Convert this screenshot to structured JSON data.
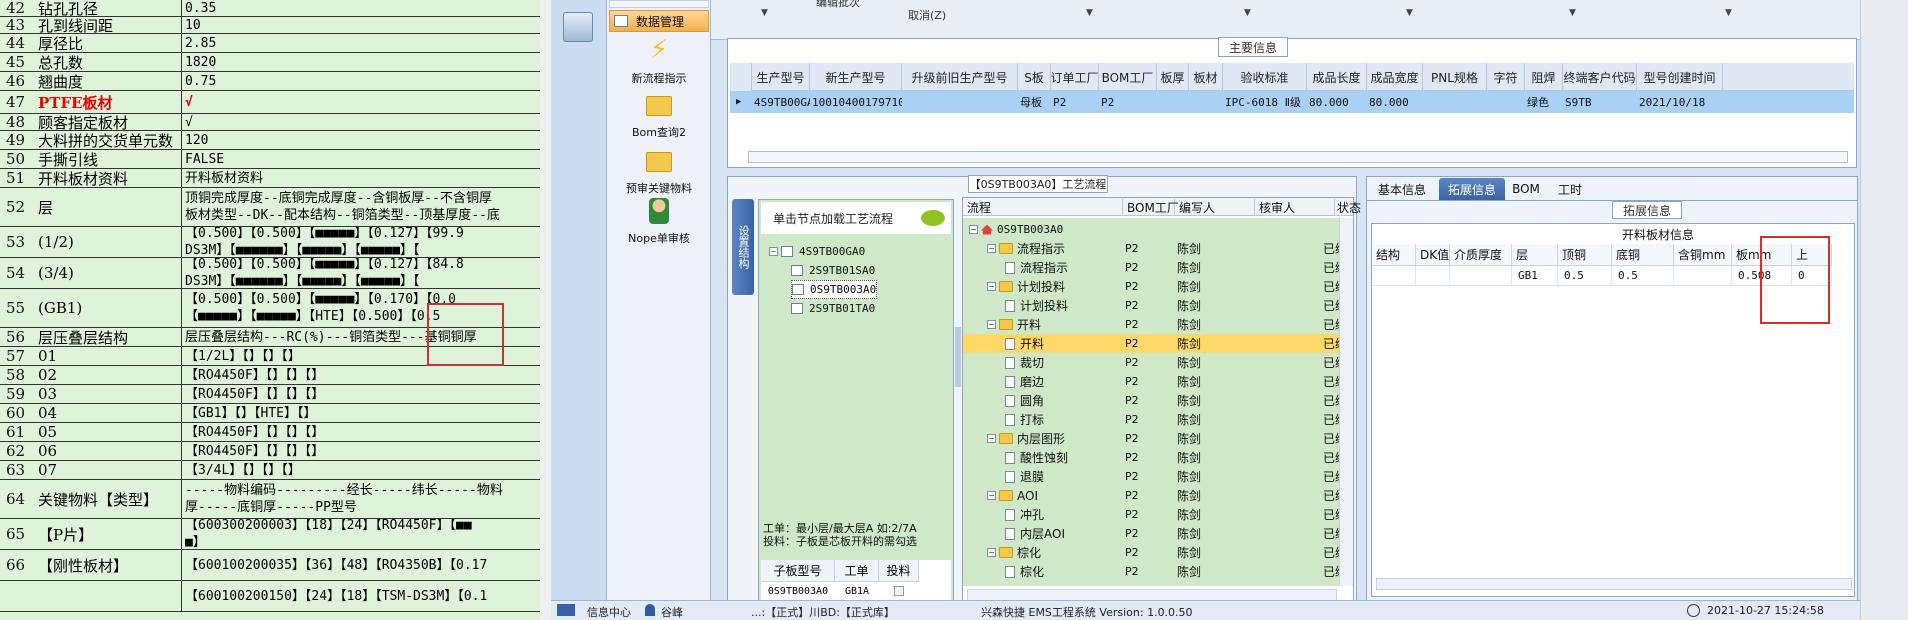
{
  "sheet": {
    "rows": [
      {
        "n": "42",
        "k": "钻孔孔径",
        "v": "0.35"
      },
      {
        "n": "43",
        "k": "孔到线间距",
        "v": "10"
      },
      {
        "n": "44",
        "k": "厚径比",
        "v": "2.85"
      },
      {
        "n": "45",
        "k": "总孔数",
        "v": "1820"
      },
      {
        "n": "46",
        "k": "翘曲度",
        "v": "0.75"
      },
      {
        "n": "47",
        "k": "PTFE板材",
        "v": "√"
      },
      {
        "n": "48",
        "k": "顾客指定板材",
        "v": "√"
      },
      {
        "n": "49",
        "k": "大料拼的交货单元数",
        "v": "120"
      },
      {
        "n": "50",
        "k": "手撕引线",
        "v": "FALSE"
      },
      {
        "n": "51",
        "k": "开料板材资料",
        "v": "开料板材资料"
      },
      {
        "n": "52",
        "k": "层",
        "v": "顶铜完成厚度--底铜完成厚度--含铜板厚--不含铜厚\n板材类型--DK--配本结构--铜箔类型--顶基厚度--底"
      },
      {
        "n": "53",
        "k": "(1/2)",
        "v": "【0.500】【0.500】【■■■■■】【0.127】【99.9\nDS3M】【■■■■■■】【■■■■■】【■■■■■】【"
      },
      {
        "n": "54",
        "k": "(3/4)",
        "v": "【0.500】【0.500】【■■■■■】【0.127】【84.8\nDS3M】【■■■■■■】【■■■■■】【■■■■■】【"
      },
      {
        "n": "55",
        "k": "(GB1)",
        "v": "【0.500】【0.500】【■■■■■】【0.170】【0.0\n【■■■■■】【■■■■■】【HTE】【0.500】【0.5"
      },
      {
        "n": "56",
        "k": "层压叠层结构",
        "v": "层压叠层结构---RC(%)---铜箔类型---基铜铜厚"
      },
      {
        "n": "57",
        "k": "01",
        "v": "【1/2L】【】【】【】"
      },
      {
        "n": "58",
        "k": "02",
        "v": "【RO4450F】【】【】【】"
      },
      {
        "n": "59",
        "k": "03",
        "v": "【RO4450F】【】【】【】"
      },
      {
        "n": "60",
        "k": "04",
        "v": "【GB1】【】【HTE】【】"
      },
      {
        "n": "61",
        "k": "05",
        "v": "【RO4450F】【】【】【】"
      },
      {
        "n": "62",
        "k": "06",
        "v": "【RO4450F】【】【】【】"
      },
      {
        "n": "63",
        "k": "07",
        "v": "【3/4L】【】【】【】"
      },
      {
        "n": "64",
        "k": "关键物料【类型】",
        "v": "-----物料编码---------经长-----纬长-----物料\n厚-----底铜厚-----PP型号"
      },
      {
        "n": "65",
        "k": "【P片】",
        "v": "【600300200003】【18】【24】【RO4450F】【■■\n■】"
      },
      {
        "n": "66",
        "k": "【刚性板材】",
        "v": "【600100200035】【36】【48】【RO4350B】【0.17"
      },
      {
        "n": "",
        "k": "",
        "v": "【600100200150】【24】【18】【TSM-DS3M】【0.1"
      }
    ]
  },
  "toolbar": {
    "top_label": "编辑批次",
    "cancel": "取消(Z)"
  },
  "nav": {
    "items": [
      {
        "label": "数据管理"
      },
      {
        "label": "新流程指示"
      },
      {
        "label": "Bom查询2"
      },
      {
        "label": "预审关键物料"
      },
      {
        "label": "Nope单审核"
      }
    ]
  },
  "main_info": {
    "title": "主要信息",
    "columns": [
      "生产型号",
      "新生产型号",
      "升级前旧生产型号",
      "S板",
      "订单工厂",
      "BOM工厂",
      "板厚",
      "板材",
      "验收标准",
      "成品长度",
      "成品宽度",
      "PNL规格",
      "字符",
      "阻焊",
      "终端客户代码",
      "型号创建时间"
    ],
    "row": [
      "4S9TB00GA0",
      "10010400179710",
      "",
      "母板",
      "P2",
      "P2",
      "",
      "",
      "IPC-6018 Ⅱ级",
      "80.000",
      "80.000",
      "",
      "",
      "绿色",
      "S9TB",
      "2021/10/18"
    ]
  },
  "process": {
    "title": "【0S9TB003A0】工艺流程",
    "side_tab": "设置结构",
    "load_hint": "单击节点加载工艺流程",
    "struct_tree": [
      {
        "label": "4S9TB00GA0",
        "level": 0
      },
      {
        "label": "2S9TB01SA0",
        "level": 1
      },
      {
        "label": "0S9TB003A0",
        "level": 1
      },
      {
        "label": "2S9TB01TA0",
        "level": 1
      }
    ],
    "note1": "工单：最小层/最大层A 如:2/7A",
    "note2": "投料：子板是芯板开料的需勾选",
    "sub_cols": [
      "子板型号",
      "工单",
      "投料"
    ],
    "sub_row": [
      "0S9TB003A0",
      "GB1A",
      ""
    ],
    "flow_cols": [
      "流程",
      "BOM工厂",
      "编写人",
      "核审人",
      "状态"
    ],
    "flow_rows": [
      {
        "name": "0S9TB003A0",
        "lvl": 0,
        "kind": "root",
        "f": "",
        "w": "",
        "r": "",
        "s": ""
      },
      {
        "name": "流程指示",
        "lvl": 1,
        "kind": "folder",
        "f": "P2",
        "w": "陈剑",
        "r": "",
        "s": "已编写"
      },
      {
        "name": "流程指示",
        "lvl": 2,
        "kind": "doc",
        "f": "P2",
        "w": "陈剑",
        "r": "",
        "s": "已编写"
      },
      {
        "name": "计划投料",
        "lvl": 1,
        "kind": "folder",
        "f": "P2",
        "w": "陈剑",
        "r": "",
        "s": "已编写"
      },
      {
        "name": "计划投料",
        "lvl": 2,
        "kind": "doc",
        "f": "P2",
        "w": "陈剑",
        "r": "",
        "s": "已编写"
      },
      {
        "name": "开料",
        "lvl": 1,
        "kind": "folder",
        "f": "P2",
        "w": "陈剑",
        "r": "",
        "s": "已编写"
      },
      {
        "name": "开料",
        "lvl": 2,
        "kind": "doc",
        "f": "P2",
        "w": "陈剑",
        "r": "",
        "s": "已编写",
        "sel": true
      },
      {
        "name": "裁切",
        "lvl": 2,
        "kind": "doc",
        "f": "P2",
        "w": "陈剑",
        "r": "",
        "s": "已编写"
      },
      {
        "name": "磨边",
        "lvl": 2,
        "kind": "doc",
        "f": "P2",
        "w": "陈剑",
        "r": "",
        "s": "已编写"
      },
      {
        "name": "圆角",
        "lvl": 2,
        "kind": "doc",
        "f": "P2",
        "w": "陈剑",
        "r": "",
        "s": "已编写"
      },
      {
        "name": "打标",
        "lvl": 2,
        "kind": "doc",
        "f": "P2",
        "w": "陈剑",
        "r": "",
        "s": "已编写"
      },
      {
        "name": "内层图形",
        "lvl": 1,
        "kind": "folder",
        "f": "P2",
        "w": "陈剑",
        "r": "",
        "s": "已编写"
      },
      {
        "name": "酸性蚀刻",
        "lvl": 2,
        "kind": "doc",
        "f": "P2",
        "w": "陈剑",
        "r": "",
        "s": "已编写"
      },
      {
        "name": "退膜",
        "lvl": 2,
        "kind": "doc",
        "f": "P2",
        "w": "陈剑",
        "r": "",
        "s": "已编写"
      },
      {
        "name": "AOI",
        "lvl": 1,
        "kind": "folder",
        "f": "P2",
        "w": "陈剑",
        "r": "",
        "s": "已编写"
      },
      {
        "name": "冲孔",
        "lvl": 2,
        "kind": "doc",
        "f": "P2",
        "w": "陈剑",
        "r": "",
        "s": "已编写"
      },
      {
        "name": "内层AOI",
        "lvl": 2,
        "kind": "doc",
        "f": "P2",
        "w": "陈剑",
        "r": "",
        "s": "已编写"
      },
      {
        "name": "棕化",
        "lvl": 1,
        "kind": "folder",
        "f": "P2",
        "w": "陈剑",
        "r": "",
        "s": "已编写"
      },
      {
        "name": "棕化",
        "lvl": 2,
        "kind": "doc",
        "f": "P2",
        "w": "陈剑",
        "r": "",
        "s": "已编写"
      }
    ]
  },
  "right": {
    "tabs": [
      "基本信息",
      "拓展信息",
      "BOM",
      "工时"
    ],
    "active_tab": "拓展信息",
    "group_title": "拓展信息",
    "table_title": "开料板材信息",
    "columns": [
      "结构",
      "DK值",
      "介质厚度",
      "层",
      "顶铜",
      "底铜",
      "含铜mm",
      "板mm",
      "上"
    ],
    "row": [
      "",
      "",
      "",
      "GB1",
      "0.5",
      "0.5",
      "",
      "0.508",
      "0"
    ]
  },
  "status": {
    "info": "信息中心",
    "user": "谷峰",
    "mid": "...:【正式】川BD:【正式库】",
    "system": "兴森快捷 EMS工程系统 Version: 1.0.0.50",
    "time": "2021-10-27 15:24:58"
  },
  "colors": {
    "accent": "#f0a020",
    "red": "#d23030",
    "header": "#dfe8f4"
  }
}
